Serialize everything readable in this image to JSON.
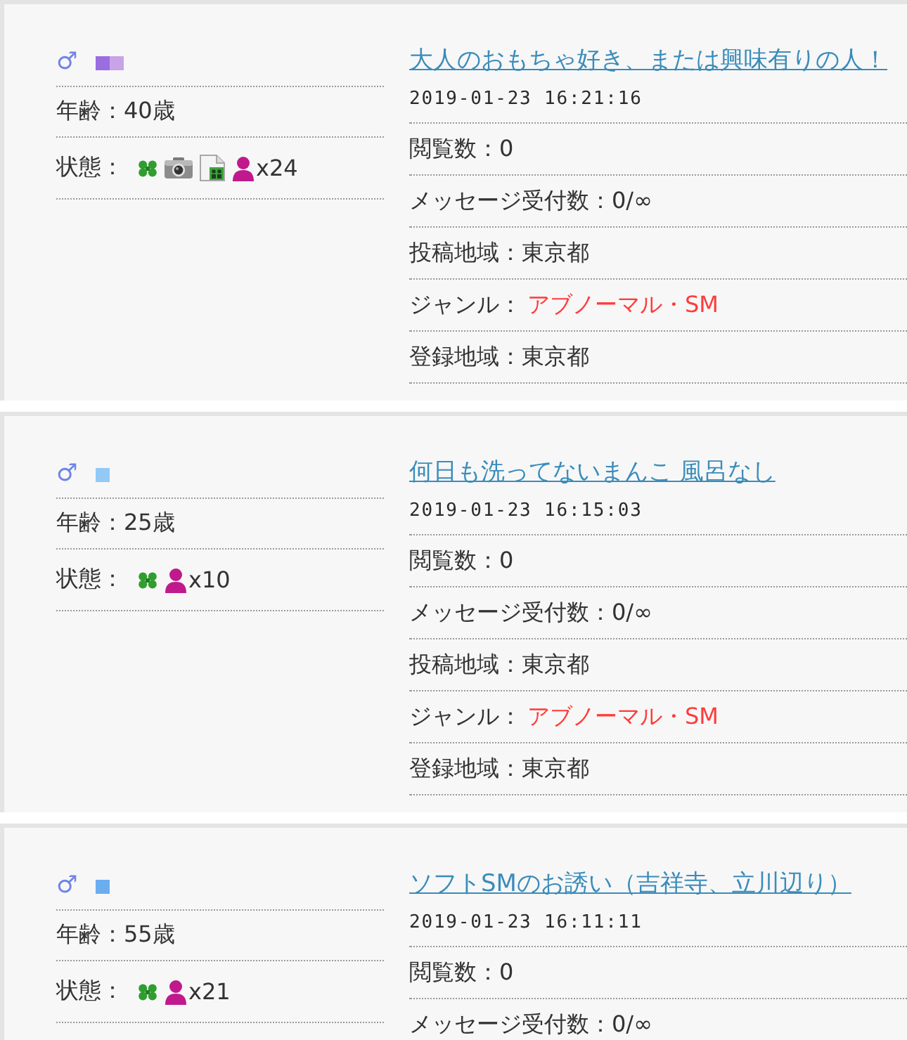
{
  "posts": [
    {
      "gender": "♂",
      "badges": [
        {
          "color": "#9a6ee0"
        },
        {
          "color": "#c9a3e8"
        }
      ],
      "age": "年齢：40歳",
      "status_label": "状態：",
      "status_icons": [
        {
          "kind": "clover"
        },
        {
          "kind": "camera"
        },
        {
          "kind": "photo"
        },
        {
          "kind": "person"
        }
      ],
      "member_count": "x24",
      "title": "大人のおもちゃ好き、または興味有りの人！",
      "datetime": "2019-01-23 16:21:16",
      "details": [
        {
          "kind": "plain",
          "label": "閲覧数：",
          "value": "0"
        },
        {
          "kind": "plain",
          "label": "メッセージ受付数：",
          "value": "0/∞"
        },
        {
          "kind": "plain",
          "label": "投稿地域：",
          "value": "東京都"
        },
        {
          "kind": "genre",
          "label": "ジャンル：",
          "value": "アブノーマル・SM"
        },
        {
          "kind": "plain",
          "label": "登録地域：",
          "value": "東京都"
        }
      ]
    },
    {
      "gender": "♂",
      "badges": [
        {
          "color": "#92c9f7"
        }
      ],
      "age": "年齢：25歳",
      "status_label": "状態：",
      "status_icons": [
        {
          "kind": "clover"
        },
        {
          "kind": "person"
        }
      ],
      "member_count": "x10",
      "title": "何日も洗ってないまんこ 風呂なし",
      "datetime": "2019-01-23 16:15:03",
      "details": [
        {
          "kind": "plain",
          "label": "閲覧数：",
          "value": "0"
        },
        {
          "kind": "plain",
          "label": "メッセージ受付数：",
          "value": "0/∞"
        },
        {
          "kind": "plain",
          "label": "投稿地域：",
          "value": "東京都"
        },
        {
          "kind": "genre",
          "label": "ジャンル：",
          "value": "アブノーマル・SM"
        },
        {
          "kind": "plain",
          "label": "登録地域：",
          "value": "東京都"
        }
      ]
    },
    {
      "gender": "♂",
      "badges": [
        {
          "color": "#6aaef0"
        }
      ],
      "age": "年齢：55歳",
      "status_label": "状態：",
      "status_icons": [
        {
          "kind": "clover"
        },
        {
          "kind": "person"
        }
      ],
      "member_count": "x21",
      "title": "ソフトSMのお誘い（吉祥寺、立川辺り）",
      "datetime": "2019-01-23 16:11:11",
      "details": [
        {
          "kind": "plain",
          "label": "閲覧数：",
          "value": "0"
        },
        {
          "kind": "plain",
          "label": "メッセージ受付数：",
          "value": "0/∞"
        }
      ]
    }
  ]
}
